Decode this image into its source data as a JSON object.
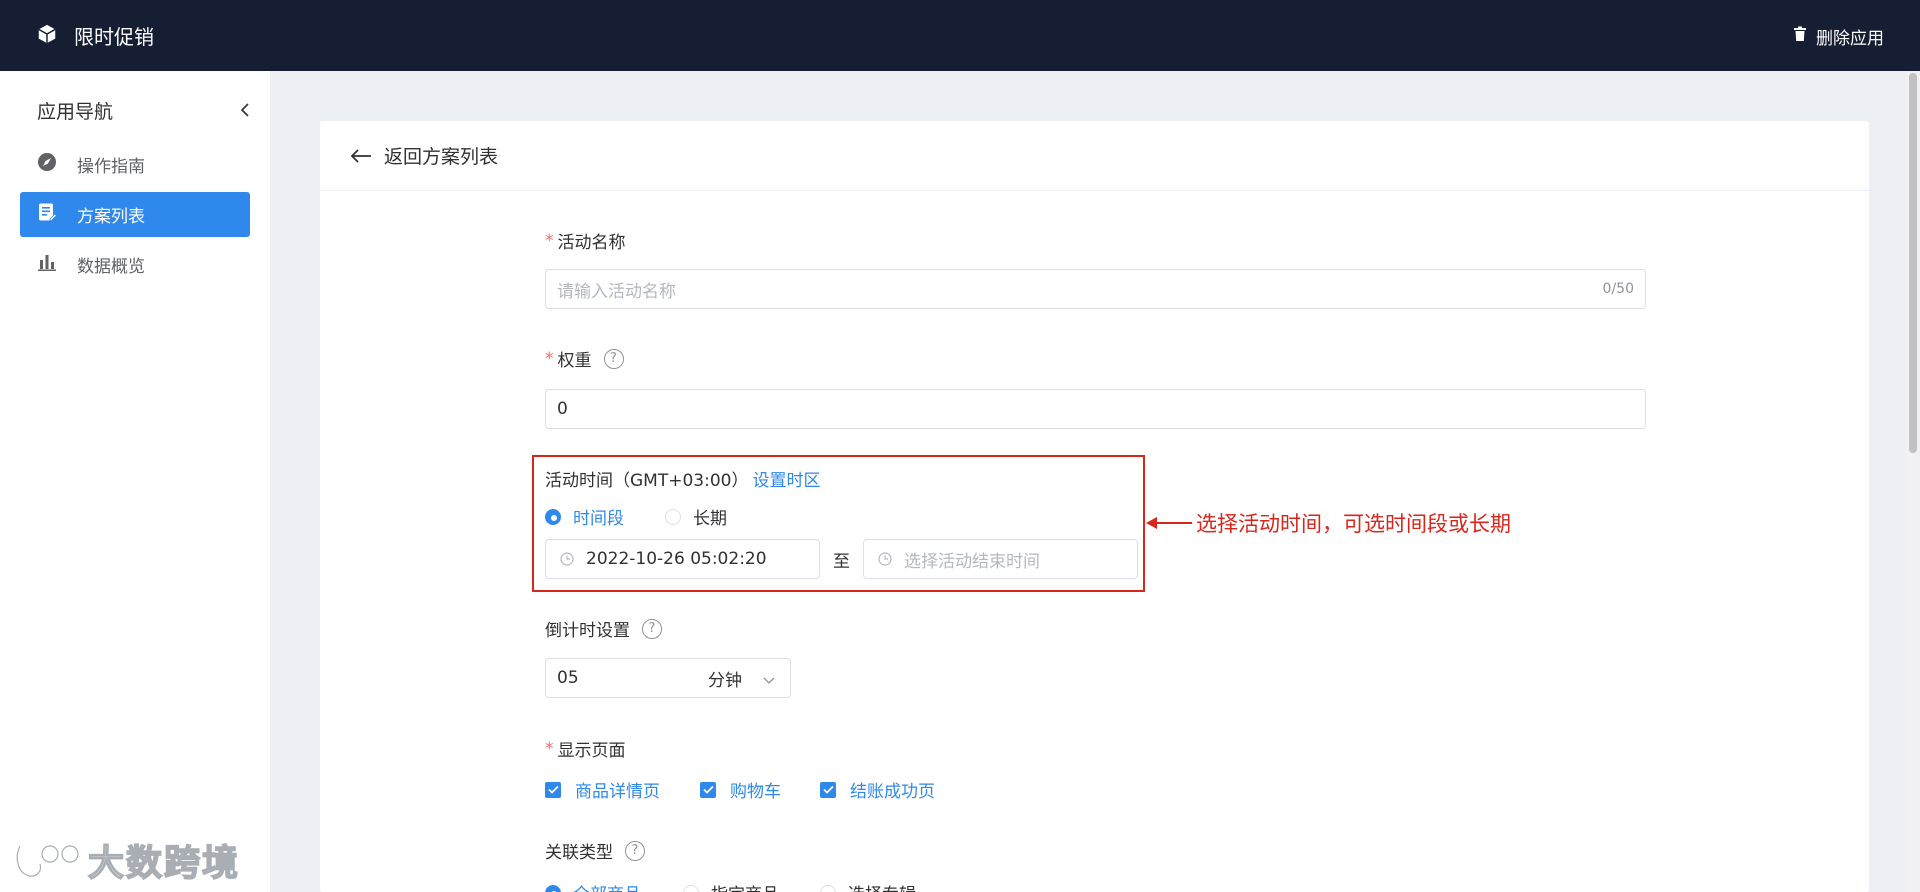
{
  "topbar": {
    "app_title": "限时促销",
    "delete_label": "删除应用",
    "colors": {
      "background": "#151e33"
    }
  },
  "sidebar": {
    "title": "应用导航",
    "items": [
      {
        "label": "操作指南",
        "icon": "navigation-icon",
        "active": false
      },
      {
        "label": "方案列表",
        "icon": "document-icon",
        "active": true
      },
      {
        "label": "数据概览",
        "icon": "bar-chart-icon",
        "active": false
      }
    ],
    "colors": {
      "active": "#2f89ec"
    }
  },
  "main": {
    "back_label": "返回方案列表",
    "form": {
      "name": {
        "label": "活动名称",
        "placeholder": "请输入活动名称",
        "counter": "0/50"
      },
      "weight": {
        "label": "权重",
        "help": "?",
        "value": "0"
      },
      "time": {
        "label": "活动时间（GMT+03:00）",
        "tz_link": "设置时区",
        "options": [
          "时间段",
          "长期"
        ],
        "selected": "时间段",
        "start": "2022-10-26 05:02:20",
        "separator": "至",
        "end_placeholder": "选择活动结束时间"
      },
      "countdown": {
        "label": "倒计时设置",
        "help": "?",
        "value": "05",
        "unit": "分钟"
      },
      "pages": {
        "label": "显示页面",
        "options": [
          "商品详情页",
          "购物车",
          "结账成功页"
        ]
      },
      "relation": {
        "label": "关联类型",
        "help": "?",
        "options": [
          "全部商品",
          "指定商品",
          "选择专辑"
        ],
        "selected": "全部商品"
      }
    }
  },
  "annotation": {
    "text": "选择活动时间，可选时间段或长期",
    "color": "#d9261c"
  },
  "watermark": {
    "text": "大数跨境"
  }
}
